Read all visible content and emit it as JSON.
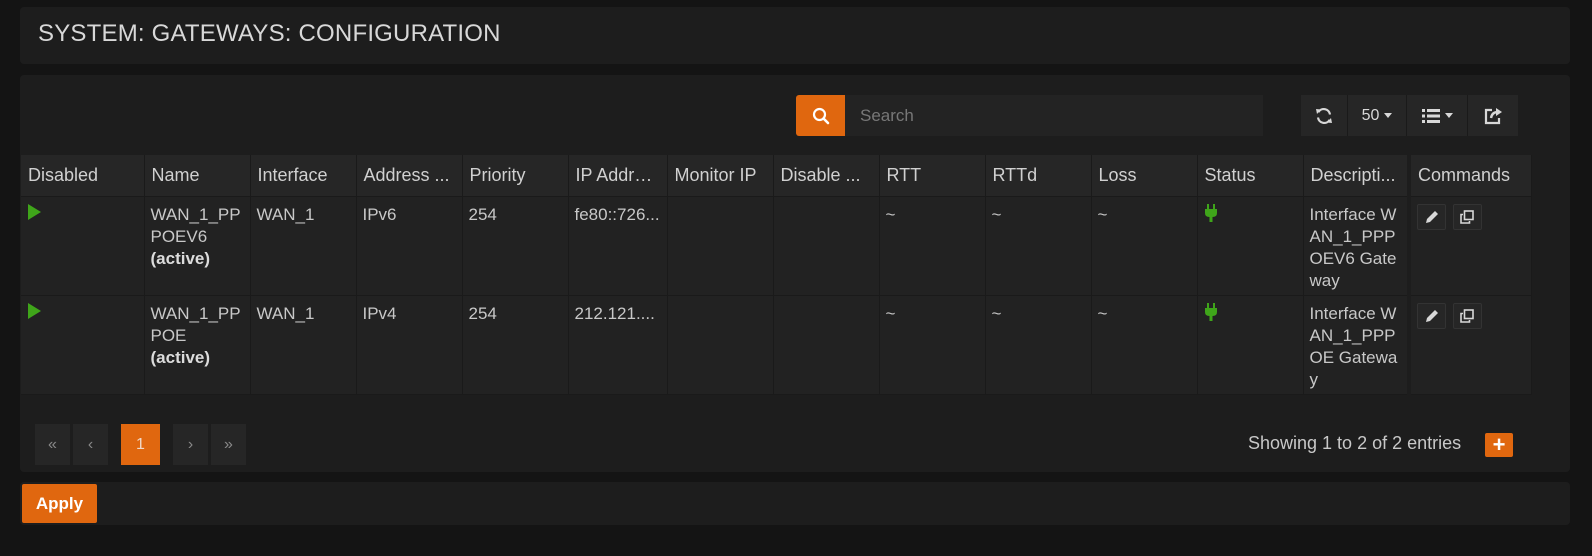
{
  "page": {
    "title": "SYSTEM: GATEWAYS: CONFIGURATION"
  },
  "toolbar": {
    "search_placeholder": "Search",
    "page_size": "50",
    "search_icon": "search-icon",
    "refresh_icon": "refresh-icon",
    "columns_icon": "list-icon",
    "export_icon": "export-icon"
  },
  "table": {
    "headers": {
      "disabled": "Disabled",
      "name": "Name",
      "interface": "Interface",
      "address_family": "Address ...",
      "priority": "Priority",
      "ip_address": "IP Address",
      "monitor_ip": "Monitor IP",
      "disable_monitoring": "Disable ...",
      "rtt": "RTT",
      "rttd": "RTTd",
      "loss": "Loss",
      "status": "Status",
      "description": "Descripti...",
      "commands": "Commands"
    },
    "rows": [
      {
        "name": "WAN_1_PPPOEV6",
        "active": "(active)",
        "interface": "WAN_1",
        "address_family": "IPv6",
        "priority": "254",
        "ip_address": "fe80::726...",
        "monitor_ip": "",
        "disable_monitoring": "",
        "rtt": "~",
        "rttd": "~",
        "loss": "~",
        "description": "Interface WAN_1_PPPOEV6 Gateway"
      },
      {
        "name": "WAN_1_PPPOE",
        "active": "(active)",
        "interface": "WAN_1",
        "address_family": "IPv4",
        "priority": "254",
        "ip_address": "212.121....",
        "monitor_ip": "",
        "disable_monitoring": "",
        "rtt": "~",
        "rttd": "~",
        "loss": "~",
        "description": "Interface WAN_1_PPPOE Gateway"
      }
    ]
  },
  "pagination": {
    "first": "«",
    "prev": "‹",
    "current": "1",
    "next": "›",
    "last": "»",
    "summary": "Showing 1 to 2 of 2 entries"
  },
  "actions": {
    "add": "+",
    "apply": "Apply"
  },
  "colors": {
    "accent": "#e0670f",
    "status_ok": "#3fa51a",
    "enabled_play": "#3fa51a"
  }
}
